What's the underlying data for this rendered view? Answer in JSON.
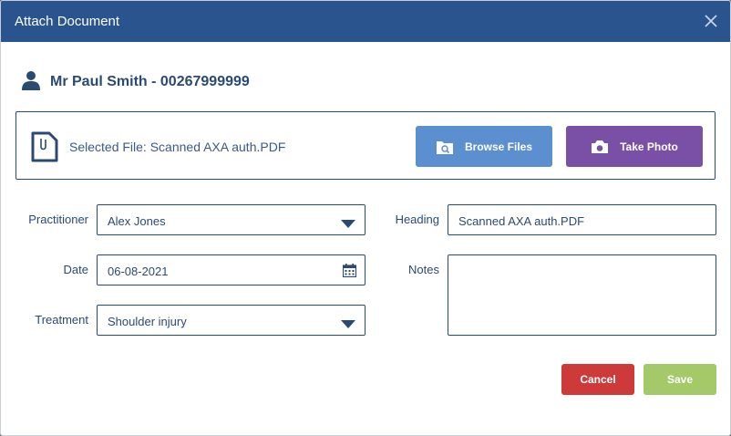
{
  "dialog": {
    "title": "Attach Document",
    "close_icon": "close-icon"
  },
  "patient": {
    "icon": "user-icon",
    "name": "Mr Paul Smith - 00267999999"
  },
  "file": {
    "icon": "document-icon",
    "selected_text": "Selected File: Scanned AXA auth.PDF",
    "browse_label": "Browse Files",
    "browse_icon": "search-folder-icon",
    "photo_label": "Take Photo",
    "photo_icon": "camera-icon"
  },
  "form": {
    "practitioner_label": "Practitioner",
    "practitioner_value": "Alex Jones",
    "date_label": "Date",
    "date_value": "06-08-2021",
    "treatment_label": "Treatment",
    "treatment_value": "Shoulder injury",
    "heading_label": "Heading",
    "heading_value": "Scanned AXA auth.PDF",
    "notes_label": "Notes",
    "notes_value": ""
  },
  "actions": {
    "cancel_label": "Cancel",
    "save_label": "Save"
  },
  "colors": {
    "titlebar": "#2a548e",
    "primary_text": "#2a4a74",
    "browse": "#5b8fd0",
    "photo": "#7a4fa6",
    "cancel": "#cc3a3a",
    "save": "#a3c968"
  }
}
